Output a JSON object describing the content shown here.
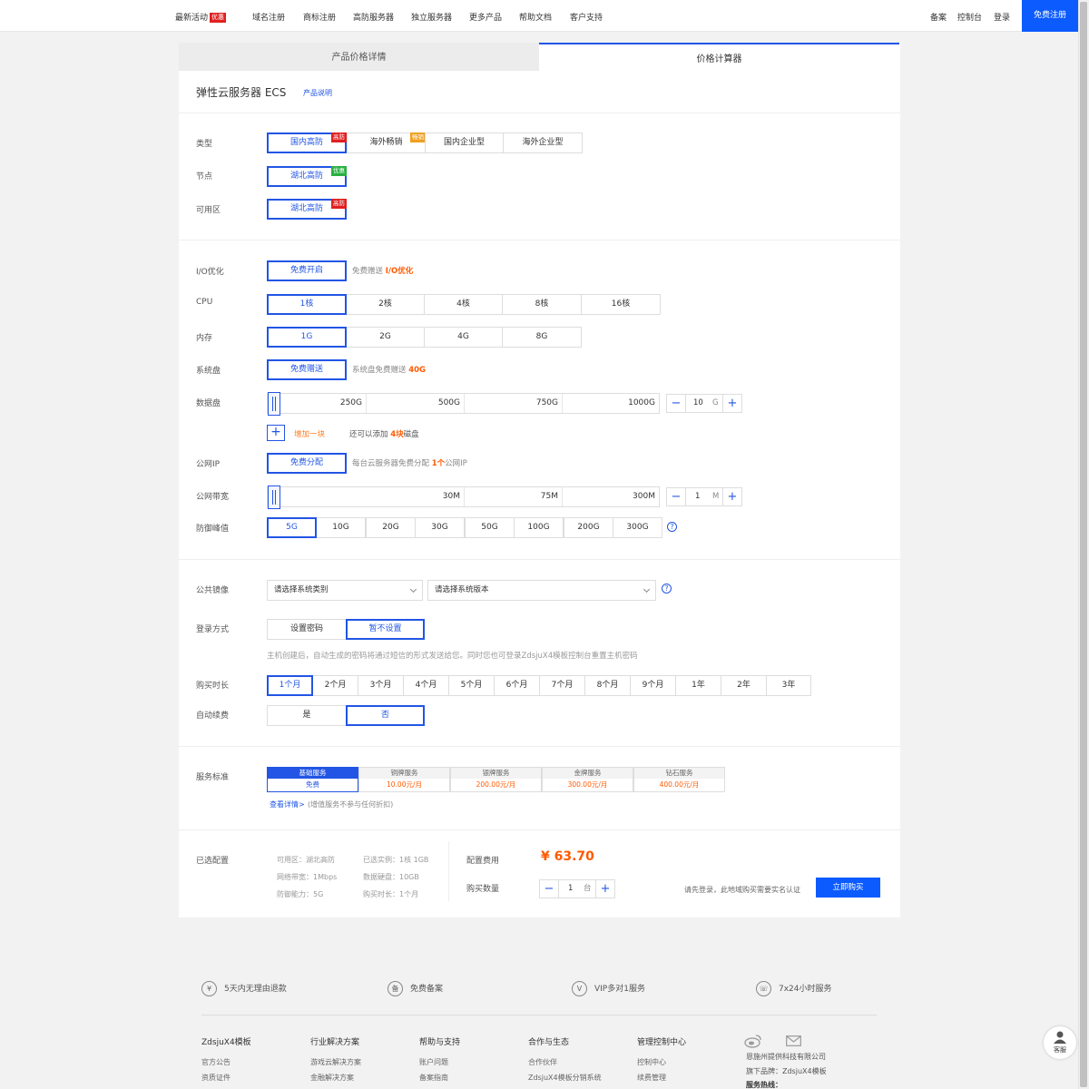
{
  "nav": {
    "items": [
      "最新活动",
      "域名注册",
      "商标注册",
      "高防服务器",
      "独立服务器",
      "更多产品",
      "帮助文档",
      "客户支持"
    ],
    "hot_badge": "优惠",
    "right": [
      "备案",
      "控制台",
      "登录"
    ],
    "register": "免费注册"
  },
  "tabs": [
    "产品价格详情",
    "价格计算器"
  ],
  "product": {
    "title": "弹性云服务器 ECS",
    "link": "产品说明"
  },
  "type": {
    "label": "类型",
    "options": [
      "国内高防",
      "海外畅销",
      "国内企业型",
      "海外企业型"
    ],
    "tags": [
      "高防",
      "畅销"
    ]
  },
  "node": {
    "label": "节点",
    "value": "湖北高防",
    "tag": "优惠"
  },
  "zone": {
    "label": "可用区",
    "value": "湖北高防",
    "tag": "高防"
  },
  "io": {
    "label": "I/O优化",
    "button": "免费开启",
    "note": "免费赠送",
    "highlight": "I/O优化"
  },
  "cpu": {
    "label": "CPU",
    "options": [
      "1核",
      "2核",
      "4核",
      "8核",
      "16核"
    ]
  },
  "mem": {
    "label": "内存",
    "options": [
      "1G",
      "2G",
      "4G",
      "8G"
    ]
  },
  "sysdisk": {
    "label": "系统盘",
    "button": "免费赠送",
    "note": "系统盘免费赠送",
    "highlight": "40G"
  },
  "datadisk": {
    "label": "数据盘",
    "marks": [
      "250G",
      "500G",
      "750G",
      "1000G"
    ],
    "value": "10",
    "unit": "G",
    "add_label": "增加一块",
    "note_pre": "还可以添加",
    "note_num": "4块",
    "note_post": "磁盘"
  },
  "ip": {
    "label": "公网IP",
    "button": "免费分配",
    "note_pre": "每台云服务器免费分配",
    "note_num": "1个",
    "note_post": "公网IP"
  },
  "bw": {
    "label": "公网带宽",
    "marks": [
      "30M",
      "75M",
      "300M"
    ],
    "value": "1",
    "unit": "M"
  },
  "ddos": {
    "label": "防御峰值",
    "options": [
      "5G",
      "10G",
      "20G",
      "30G",
      "50G",
      "100G",
      "200G",
      "300G"
    ]
  },
  "image": {
    "label": "公共镜像",
    "placeholder1": "请选择系统类别",
    "placeholder2": "请选择系统版本"
  },
  "login": {
    "label": "登录方式",
    "options": [
      "设置密码",
      "暂不设置"
    ],
    "note": "主机创建后，自动生成的密码将通过短信的形式发送给您。同时您也可登录ZdsjuX4模板控制台重置主机密码"
  },
  "duration": {
    "label": "购买时长",
    "options": [
      "1个月",
      "2个月",
      "3个月",
      "4个月",
      "5个月",
      "6个月",
      "7个月",
      "8个月",
      "9个月",
      "1年",
      "2年",
      "3年"
    ]
  },
  "renew": {
    "label": "自动续费",
    "options": [
      "是",
      "否"
    ]
  },
  "service": {
    "label": "服务标准",
    "items": [
      {
        "name": "基础服务",
        "price": "免费"
      },
      {
        "name": "铜牌服务",
        "price": "10.00元/月"
      },
      {
        "name": "银牌服务",
        "price": "200.00元/月"
      },
      {
        "name": "金牌服务",
        "price": "300.00元/月"
      },
      {
        "name": "钻石服务",
        "price": "400.00元/月"
      }
    ],
    "detail_link": "查看详情>",
    "detail_note": "(增值服务不参与任何折扣)"
  },
  "summary": {
    "label": "已选配置",
    "items": [
      "可用区：湖北高防",
      "已选实例：1核 1GB",
      "网络带宽：1Mbps",
      "数据硬盘：10GB",
      "防御能力：5G",
      "购买时长：1个月"
    ],
    "fee_label": "配置费用",
    "price": "¥ 63.70",
    "qty_label": "购买数量",
    "qty": "1",
    "qty_unit": "台",
    "login_note": "请先登录，此地域购买需要实名认证",
    "buy": "立即购买"
  },
  "footer": {
    "features": [
      {
        "icon": "¥",
        "text": "5天内无理由退款"
      },
      {
        "icon": "备",
        "text": "免费备案"
      },
      {
        "icon": "V",
        "text": "VIP多对1服务"
      },
      {
        "icon": "☏",
        "text": "7x24小时服务"
      }
    ],
    "columns": [
      {
        "title": "ZdsjuX4模板",
        "links": [
          "官方公告",
          "资质证件"
        ]
      },
      {
        "title": "行业解决方案",
        "links": [
          "游戏云解决方案",
          "金融解决方案"
        ]
      },
      {
        "title": "帮助与支持",
        "links": [
          "账户问题",
          "备案指南"
        ]
      },
      {
        "title": "合作与生态",
        "links": [
          "合作伙伴",
          "ZdsjuX4模板分销系统"
        ]
      },
      {
        "title": "管理控制中心",
        "links": [
          "控制中心",
          "续费管理"
        ]
      }
    ],
    "company": "恩施州提供科技有限公司",
    "brand": "旗下品牌：ZdsjuX4模板",
    "hotline": "服务热线：",
    "kefu": "客服"
  },
  "colors": {
    "accent": "#2255e5",
    "button": "#0b5bff",
    "price": "#ff5a00"
  }
}
